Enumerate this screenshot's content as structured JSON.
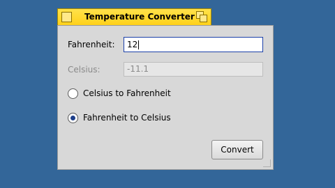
{
  "window": {
    "title": "Temperature Converter"
  },
  "form": {
    "fahrenheit_label": "Fahrenheit:",
    "fahrenheit_value": "12",
    "celsius_label": "Celsius:",
    "celsius_value": "-11.1"
  },
  "modes": [
    {
      "label": "Celsius to Fahrenheit",
      "selected": false
    },
    {
      "label": "Fahrenheit to Celsius",
      "selected": true
    }
  ],
  "actions": {
    "convert_label": "Convert"
  },
  "colors": {
    "desktop": "#336699",
    "title_bar": "#ffd11a",
    "window_bg": "#d8d8d8",
    "focus_border": "#1a3fa8"
  }
}
